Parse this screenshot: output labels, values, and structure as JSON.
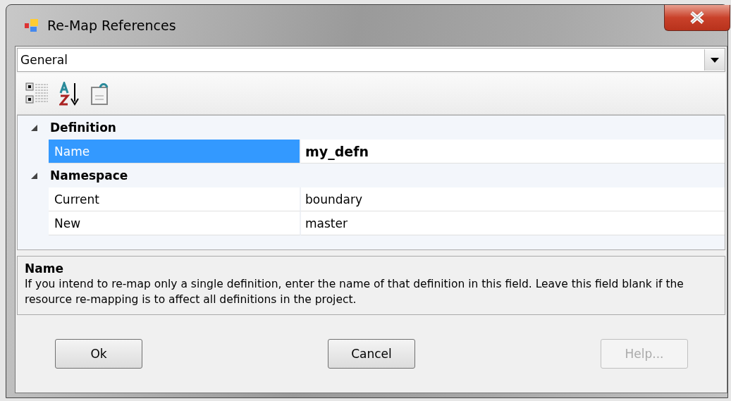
{
  "window": {
    "title": "Re-Map References"
  },
  "category_dropdown": {
    "value": "General"
  },
  "property_grid": {
    "categories": [
      {
        "label": "Definition",
        "expanded": true,
        "properties": [
          {
            "name": "Name",
            "value": "my_defn",
            "selected": true,
            "modified": true
          }
        ]
      },
      {
        "label": "Namespace",
        "expanded": true,
        "properties": [
          {
            "name": "Current",
            "value": "boundary",
            "selected": false,
            "modified": false
          },
          {
            "name": "New",
            "value": "master",
            "selected": false,
            "modified": false
          }
        ]
      }
    ]
  },
  "description": {
    "title": "Name",
    "text": "If you intend to re-map only a single definition, enter the name of that definition in this field. Leave this field blank if the resource re-mapping is to affect all definitions in the project."
  },
  "buttons": [
    {
      "label": "Ok",
      "disabled": false
    },
    {
      "label": "Cancel",
      "disabled": false
    },
    {
      "label": "Help...",
      "disabled": true
    }
  ]
}
